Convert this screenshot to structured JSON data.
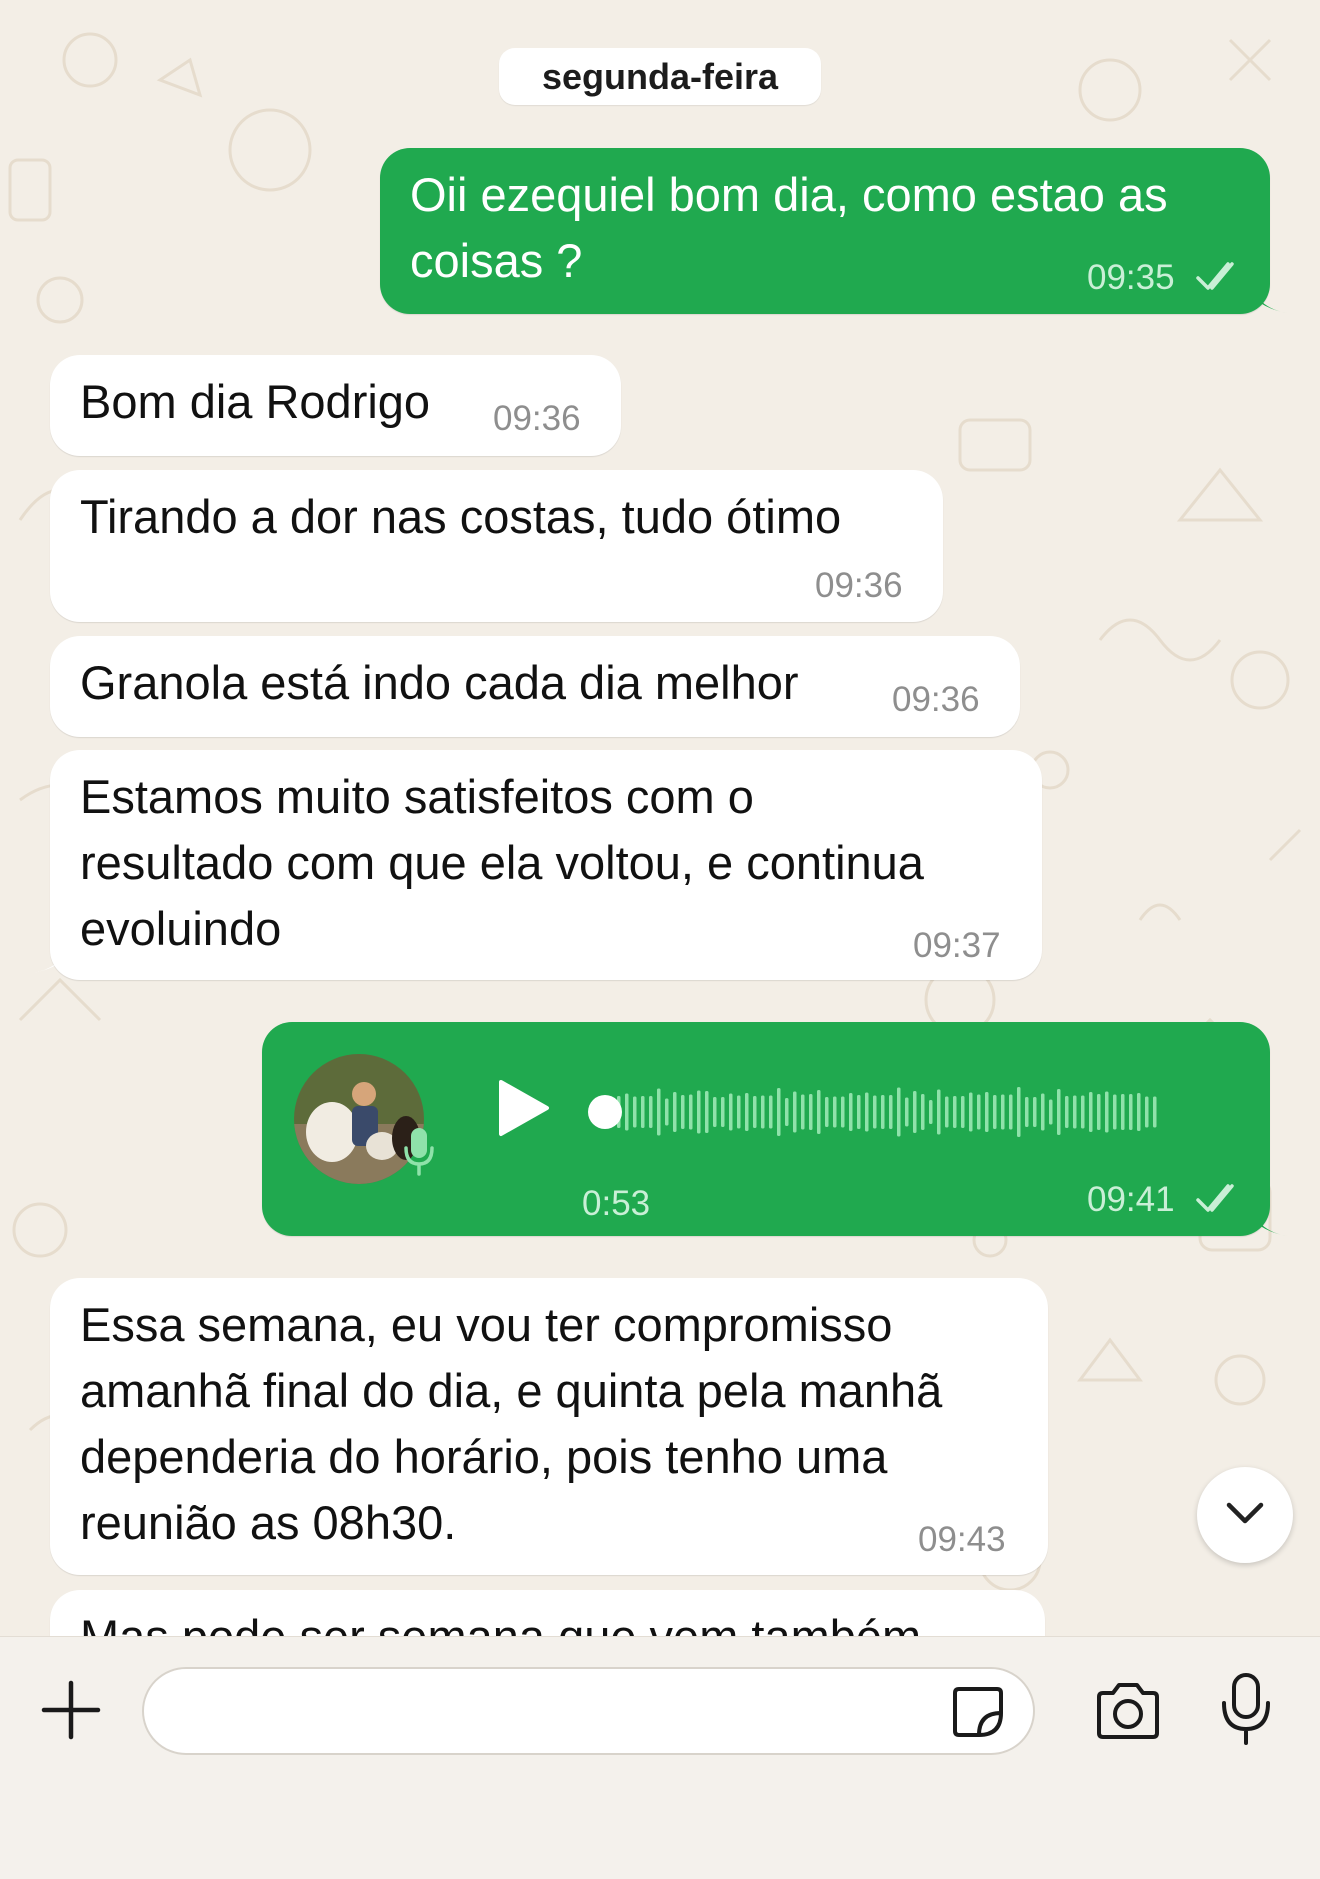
{
  "chat": {
    "date_separator": "segunda-feira",
    "messages": [
      {
        "direction": "outgoing",
        "lines": [
          "Oii ezequiel bom dia, como estao as",
          "coisas ?"
        ],
        "time": "09:35",
        "status": "read"
      },
      {
        "direction": "incoming",
        "lines": [
          "Bom dia Rodrigo"
        ],
        "time": "09:36"
      },
      {
        "direction": "incoming",
        "lines": [
          "Tirando a dor nas costas, tudo ótimo"
        ],
        "time": "09:36"
      },
      {
        "direction": "incoming",
        "lines": [
          "Granola está indo cada dia melhor"
        ],
        "time": "09:36"
      },
      {
        "direction": "incoming",
        "lines": [
          "Estamos muito satisfeitos com o",
          "resultado com que ela voltou, e continua",
          "evoluindo"
        ],
        "time": "09:37"
      },
      {
        "direction": "outgoing",
        "type": "voice",
        "duration": "0:53",
        "time": "09:41",
        "status": "read",
        "played_fraction": 0
      },
      {
        "direction": "incoming",
        "lines": [
          "Essa semana, eu vou ter compromisso",
          "amanhã final do dia, e quinta pela manhã",
          "dependeria do horário, pois tenho uma",
          "reunião as 08h30."
        ],
        "time": "09:43"
      },
      {
        "direction": "incoming",
        "lines": [
          "Mas pode ser semana que vem também"
        ],
        "partially_visible": true
      }
    ]
  },
  "composer": {
    "input_value": "",
    "icons": [
      "plus-icon",
      "sticker-icon",
      "camera-icon",
      "microphone-icon"
    ]
  },
  "colors": {
    "outgoing_bubble": "#20a94f",
    "incoming_bubble": "#ffffff",
    "wallpaper": "#f3eee6",
    "read_ticks": "#c9efd6"
  }
}
